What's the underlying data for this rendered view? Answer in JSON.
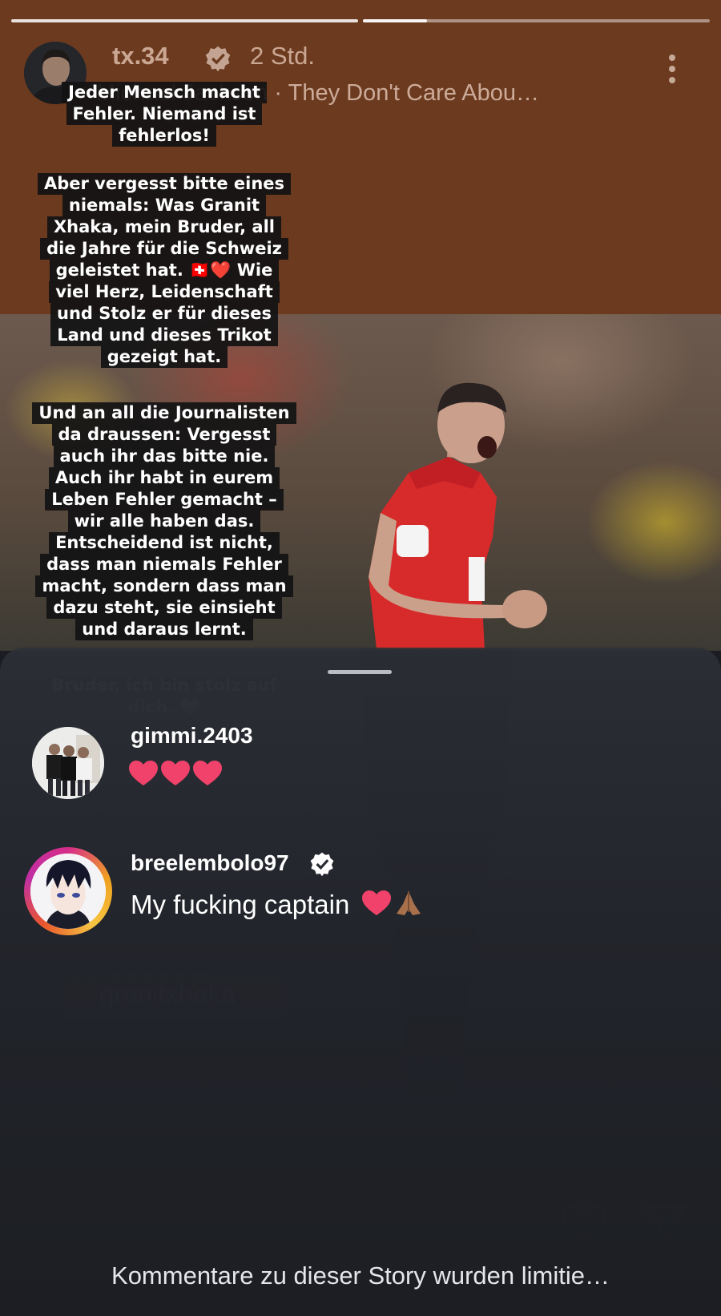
{
  "header": {
    "username": "tx.34",
    "time_ago": "2 Std.",
    "music": "Michael Jackson · They Don't Care Abou…"
  },
  "story_text": {
    "para1": [
      "Jeder Mensch macht",
      "Fehler. Niemand ist",
      "fehlerlos!"
    ],
    "para2": [
      "Aber vergesst bitte eines",
      "niemals: Was Granit",
      "Xhaka, mein Bruder, all",
      "die Jahre für die Schweiz",
      "geleistet hat. 🇨🇭❤️ Wie",
      "viel Herz, Leidenschaft",
      "und Stolz er für dieses",
      "Land und dieses Trikot",
      "gezeigt hat."
    ],
    "para3": [
      "Und an all die Journalisten",
      "da draussen: Vergesst",
      "auch ihr das bitte nie.",
      "Auch ihr habt in eurem",
      "Leben Fehler gemacht –",
      "wir alle haben das.",
      "Entscheidend ist nicht,",
      "dass man niemals Fehler",
      "macht, sondern dass man",
      "dazu steht, sie einsieht",
      "und daraus lernt."
    ],
    "para4": [
      "Bruder, ich bin stolz auf",
      "dich. 🤍"
    ],
    "hashtag": "granitxhaka"
  },
  "comments": [
    {
      "username": "gimmi.2403",
      "text": "",
      "hearts": 3
    },
    {
      "username": "breelembolo97",
      "text": "My fucking captain",
      "verified": true
    }
  ],
  "footer": {
    "note": "Kommentare zu dieser Story wurden limitie…"
  },
  "colors": {
    "story_bg": "#6c3a1f",
    "heart": "#f0426a",
    "verified": "#ffffff"
  }
}
